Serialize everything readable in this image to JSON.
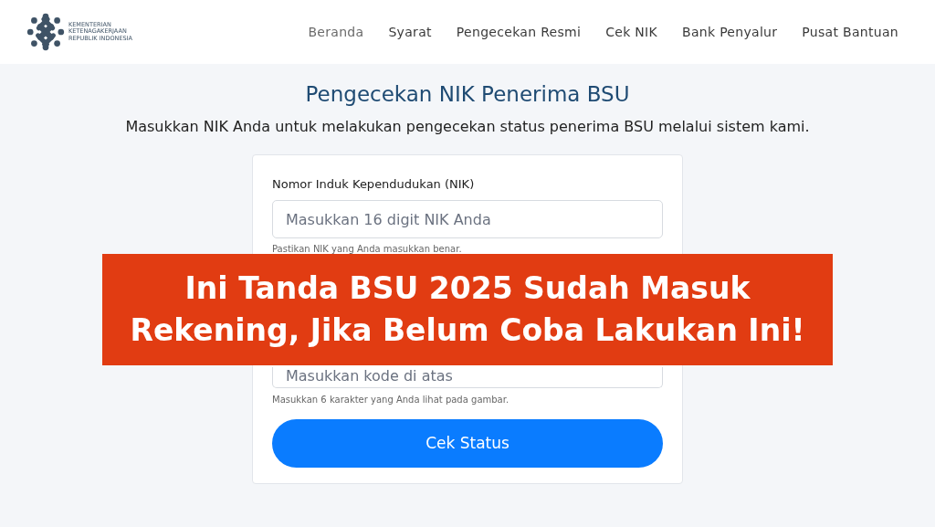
{
  "logo": {
    "lines": [
      "KEMENTERIAN",
      "KETENAGAKERJAAN",
      "REPUBLIK INDONESIA"
    ]
  },
  "nav": [
    {
      "label": "Beranda",
      "selected": true
    },
    {
      "label": "Syarat",
      "selected": false
    },
    {
      "label": "Pengecekan Resmi",
      "selected": false
    },
    {
      "label": "Cek NIK",
      "selected": false
    },
    {
      "label": "Bank Penyalur",
      "selected": false
    },
    {
      "label": "Pusat Bantuan",
      "selected": false
    }
  ],
  "page": {
    "title": "Pengecekan NIK Penerima BSU",
    "subtitle": "Masukkan NIK Anda untuk melakukan pengecekan status penerima BSU melalui sistem kami."
  },
  "form": {
    "nik_label": "Nomor Induk Kependudukan (NIK)",
    "nik_placeholder": "Masukkan 16 digit NIK Anda",
    "nik_hint": "Pastikan NIK yang Anda masukkan benar.",
    "code_placeholder": "Masukkan kode di atas",
    "code_hint": "Masukkan 6 karakter yang Anda lihat pada gambar.",
    "submit": "Cek Status"
  },
  "banner": {
    "lines": [
      "Ini Tanda BSU 2025 Sudah Masuk",
      "Rekening, Jika Belum Coba Lakukan Ini!"
    ]
  }
}
